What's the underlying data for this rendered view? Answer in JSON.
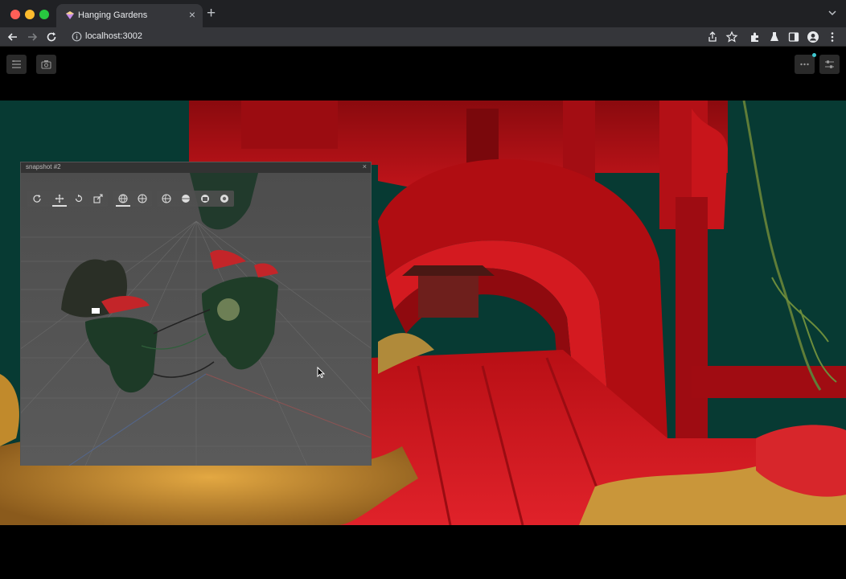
{
  "browser": {
    "tab_title": "Hanging Gardens",
    "url": "localhost:3002"
  },
  "app": {
    "left_buttons": [
      "layers-icon",
      "camera-icon"
    ],
    "right_buttons": [
      "more-icon",
      "sliders-icon"
    ]
  },
  "snapshot": {
    "title": "snapshot #2",
    "tools": [
      "refresh-icon",
      "move-icon",
      "rotate-icon",
      "scale-icon",
      "globe-icon",
      "world-icon",
      "globe-local-icon",
      "sphere-icon",
      "cube-icon",
      "render-icon"
    ]
  },
  "colors": {
    "scene_bg": "#073a33",
    "red": "#b00d12",
    "accent": "#3ec8d0"
  }
}
